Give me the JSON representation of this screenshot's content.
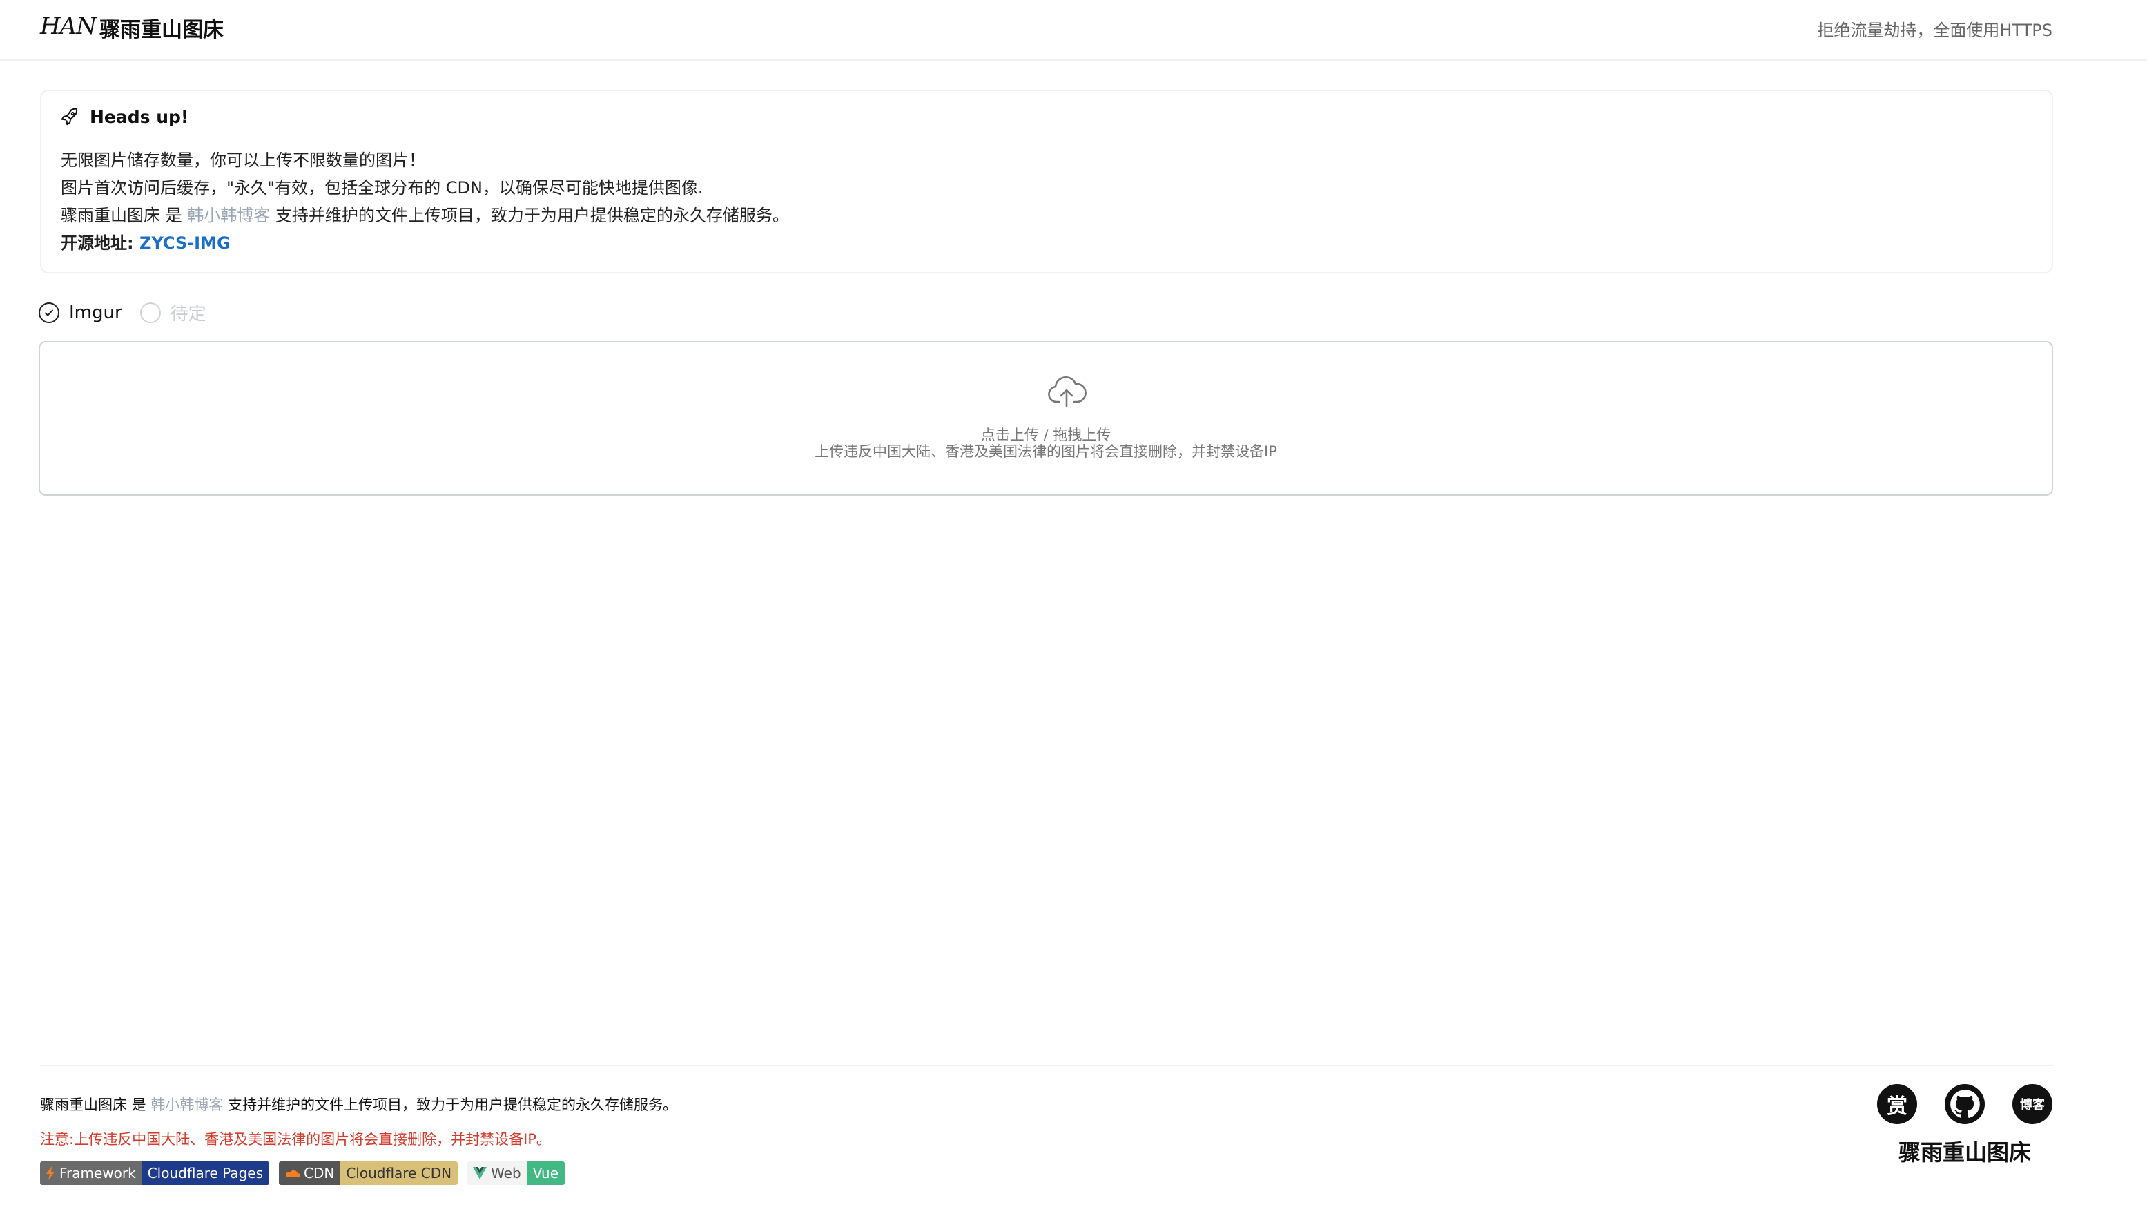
{
  "header": {
    "logo_text": "HAN",
    "title": "骤雨重山图床",
    "tagline": "拒绝流量劫持，全面使用HTTPS"
  },
  "alert": {
    "icon": "rocket-icon",
    "title": "Heads up!",
    "line1": "无限图片储存数量，你可以上传不限数量的图片！",
    "line2": "图片首次访问后缓存，\"永久\"有效，包括全球分布的 CDN，以确保尽可能快地提供图像.",
    "line3_prefix": "骤雨重山图床 是 ",
    "line3_link": "韩小韩博客",
    "line3_suffix": " 支持并维护的文件上传项目，致力于为用户提供稳定的永久存储服务。",
    "line4_label": "开源地址: ",
    "line4_link": "ZYCS-IMG"
  },
  "options": [
    {
      "label": "Imgur",
      "selected": true
    },
    {
      "label": "待定",
      "selected": false
    }
  ],
  "upload": {
    "icon": "cloud-upload-icon",
    "text1": "点击上传 / 拖拽上传",
    "text2": "上传违反中国大陆、香港及美国法律的图片将会直接删除，并封禁设备IP"
  },
  "footer": {
    "line1_prefix": "骤雨重山图床 是 ",
    "line1_link": "韩小韩博客",
    "line1_suffix": " 支持并维护的文件上传项目，致力于为用户提供稳定的永久存储服务。",
    "warning": "注意:上传违反中国大陆、香港及美国法律的图片将会直接删除，并封禁设备IP。",
    "badges": [
      {
        "left": "Framework",
        "right": "Cloudflare Pages",
        "icon": "bolt-icon"
      },
      {
        "left": "CDN",
        "right": "Cloudflare CDN",
        "icon": "cloud-icon"
      },
      {
        "left": "Web",
        "right": "Vue",
        "icon": "vue-icon"
      }
    ],
    "social": [
      {
        "label": "赏",
        "icon": "reward-icon"
      },
      {
        "label": "",
        "icon": "github-icon"
      },
      {
        "label": "博客",
        "icon": "blog-icon"
      }
    ],
    "brand": "骤雨重山图床"
  },
  "colors": {
    "link_gray": "#9aa7b6",
    "link_blue": "#1a6ec8",
    "warning_red": "#d23a2a",
    "vue_green": "#42b883"
  }
}
